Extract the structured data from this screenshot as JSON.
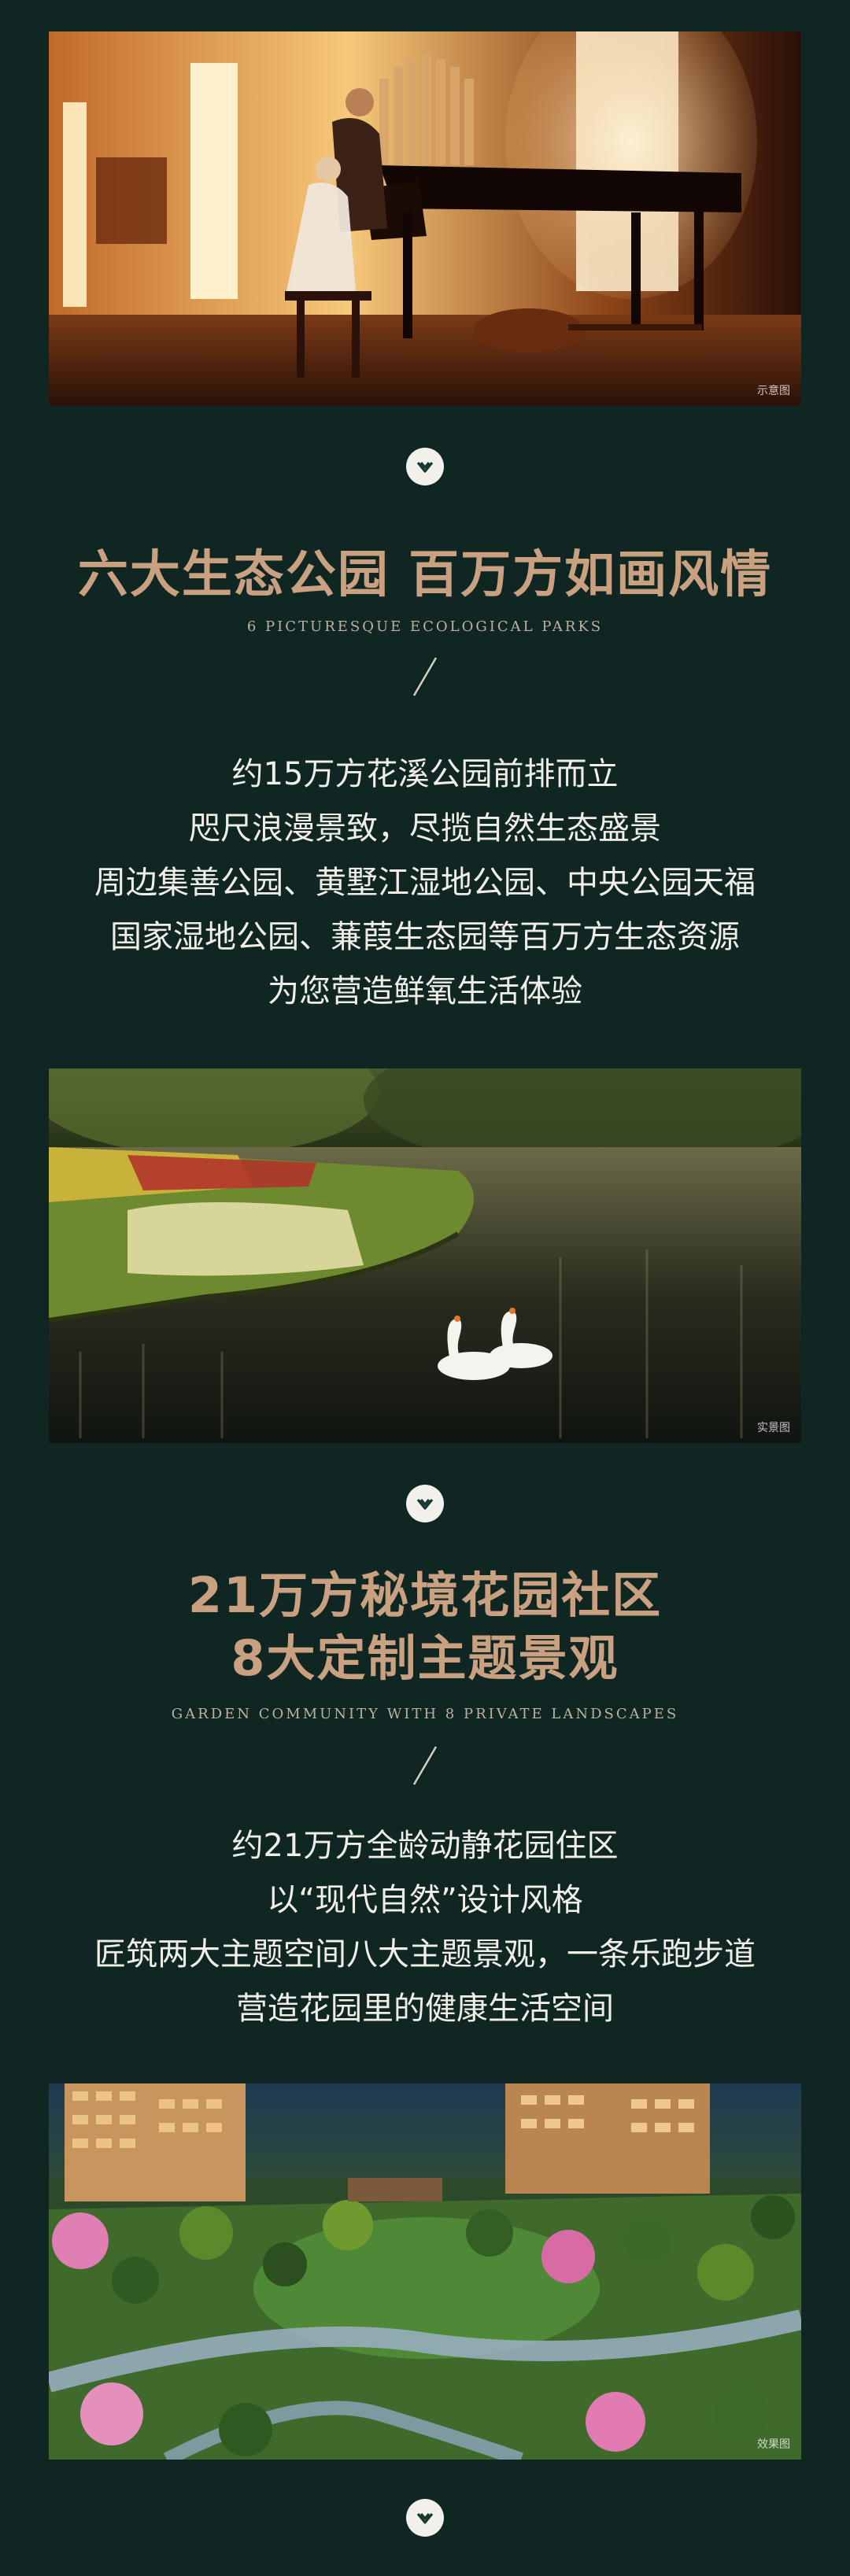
{
  "colors": {
    "background": "#0f2622",
    "title_accent": "#c9a080",
    "body_text": "#f0eee7",
    "subtitle": "#c6b9a7",
    "circle": "#f2f0ea",
    "chevron": "#163a33"
  },
  "images": {
    "piano": {
      "caption": "示意图"
    },
    "swan_lake": {
      "caption": "实景图"
    },
    "garden": {
      "caption": "效果图"
    }
  },
  "sections": {
    "parks": {
      "title": "六大生态公园 百万方如画风情",
      "subtitle": "6 Picturesque Ecological Parks",
      "lines": [
        "约15万方花溪公园前排而立",
        "咫尺浪漫景致，尽揽自然生态盛景",
        "周边集善公园、黄墅江湿地公园、中央公园天福",
        "国家湿地公园、蒹葭生态园等百万方生态资源",
        "为您营造鲜氧生活体验"
      ]
    },
    "garden": {
      "title_line1": "21万方秘境花园社区",
      "title_line2": "8大定制主题景观",
      "subtitle": "Garden Community with 8 Private Landscapes",
      "lines": [
        "约21万方全龄动静花园住区",
        "以“现代自然”设计风格",
        "匠筑两大主题空间八大主题景观，一条乐跑步道",
        "营造花园里的健康生活空间"
      ]
    }
  },
  "icons": {
    "down": "chevron-down-circle-icon",
    "divider": "slash-divider-icon"
  }
}
